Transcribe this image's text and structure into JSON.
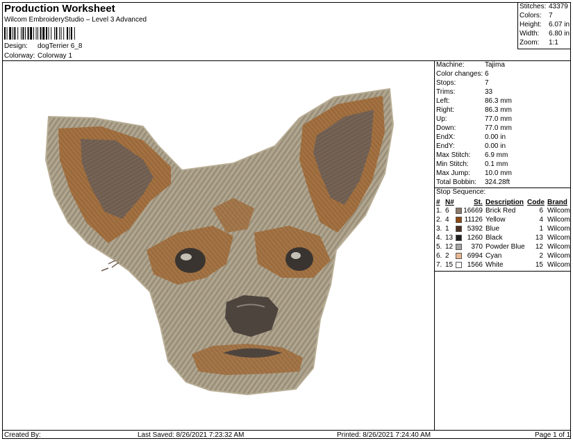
{
  "header": {
    "title": "Production Worksheet",
    "software": "Wilcom EmbroideryStudio – Level 3 Advanced",
    "design_label": "Design:",
    "design_value": "dogTerrier 6_8",
    "colorway_label": "Colorway:",
    "colorway_value": "Colorway 1"
  },
  "summary": [
    {
      "label": "Stitches:",
      "value": "43379"
    },
    {
      "label": "Colors:",
      "value": "7"
    },
    {
      "label": "Height:",
      "value": "6.07 in"
    },
    {
      "label": "Width:",
      "value": "6.80 in"
    },
    {
      "label": "Zoom:",
      "value": "1:1"
    }
  ],
  "machine_info": [
    {
      "label": "Machine:",
      "value": "Tajima"
    },
    {
      "label": "Color changes:",
      "value": "6"
    },
    {
      "label": "Stops:",
      "value": "7"
    },
    {
      "label": "Trims:",
      "value": "33"
    },
    {
      "label": "Left:",
      "value": "86.3 mm"
    },
    {
      "label": "Right:",
      "value": "86.3 mm"
    },
    {
      "label": "Up:",
      "value": "77.0 mm"
    },
    {
      "label": "Down:",
      "value": "77.0 mm"
    },
    {
      "label": "EndX:",
      "value": "0.00 in"
    },
    {
      "label": "EndY:",
      "value": "0.00 in"
    },
    {
      "label": "Max Stitch:",
      "value": "6.9 mm"
    },
    {
      "label": "Min Stitch:",
      "value": "0.1 mm"
    },
    {
      "label": "Max Jump:",
      "value": "10.0 mm"
    },
    {
      "label": "Total Bobbin:",
      "value": "324.28ft"
    }
  ],
  "stop_sequence": {
    "title": "Stop Sequence:",
    "headers": {
      "num": "#",
      "n": "N#",
      "st": "St.",
      "description": "Description",
      "code": "Code",
      "brand": "Brand"
    },
    "rows": [
      {
        "num": "1.",
        "n": "6",
        "color": "#8c7a6b",
        "st": "16669",
        "description": "Brick Red",
        "code": "6",
        "brand": "Wilcom"
      },
      {
        "num": "2.",
        "n": "4",
        "color": "#8b4a12",
        "st": "11126",
        "description": "Yellow",
        "code": "4",
        "brand": "Wilcom"
      },
      {
        "num": "3.",
        "n": "1",
        "color": "#4a2f22",
        "st": "5392",
        "description": "Blue",
        "code": "1",
        "brand": "Wilcom"
      },
      {
        "num": "4.",
        "n": "13",
        "color": "#1f1f1f",
        "st": "1260",
        "description": "Black",
        "code": "13",
        "brand": "Wilcom"
      },
      {
        "num": "5.",
        "n": "12",
        "color": "#a6a6a6",
        "st": "370",
        "description": "Powder Blue",
        "code": "12",
        "brand": "Wilcom"
      },
      {
        "num": "6.",
        "n": "2",
        "color": "#e8b894",
        "st": "6994",
        "description": "Cyan",
        "code": "2",
        "brand": "Wilcom"
      },
      {
        "num": "7.",
        "n": "15",
        "color": "#ffffff",
        "st": "1566",
        "description": "White",
        "code": "15",
        "brand": "Wilcom"
      }
    ]
  },
  "footer": {
    "created_by": "Created By:",
    "last_saved": "Last Saved: 8/26/2021 7:23:32 AM",
    "printed": "Printed: 8/26/2021 7:24:40 AM",
    "page": "Page 1 of 1"
  },
  "design_colors": {
    "fur_light": "#a79c86",
    "fur_mid": "#8f8470",
    "fur_brown": "#9b6a3c",
    "ear_inner": "#6f5d50",
    "eye": "#3a3430",
    "nose": "#4e443e",
    "highlight": "#e9e4d8"
  }
}
